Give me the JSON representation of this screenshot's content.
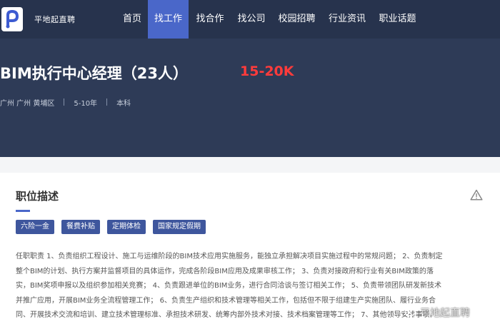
{
  "navbar": {
    "brand": "平地起直聘",
    "items": [
      {
        "label": "首页"
      },
      {
        "label": "找工作"
      },
      {
        "label": "找合作"
      },
      {
        "label": "找公司"
      },
      {
        "label": "校园招聘"
      },
      {
        "label": "行业资讯"
      },
      {
        "label": "职业话题"
      }
    ],
    "active_item": "找工作"
  },
  "job": {
    "title": "BIM执行中心经理（23人）",
    "salary": "15-20K",
    "location": "广州 广州 黄埔区",
    "experience": "5-10年",
    "education": "本科"
  },
  "description": {
    "section_title": "职位描述",
    "tags": [
      "六险一金",
      "餐费补贴",
      "定期体检",
      "国家规定假期"
    ],
    "text": "任职职责 1、负责组织工程设计、施工与运维阶段的BIM技术应用实施服务，能独立承担解决项目实施过程中的常规问题； 2、负责制定\n整个BIM的计划、执行方案并监督项目的具体运作，完成各阶段BIM应用及成果审核工作； 3、负责对接政府和行业有关BIM政策的落\n实，BIM奖项申报以及组织参加相关竞赛； 4、负责跟进单位的BIM业务，进行合同洽谈与签订相关工作； 5、负责带领团队研发新技术\n并推广应用，开展BIM业务全流程管理工作； 6、负责生产组织和技术管理等相关工作，包括但不限于组建生产实施团队、履行业务合\n同、开展技术交流和培训、建立技术管理标准、承担技术研发、统筹内部外技术对接、技术档案管理等工作； 7、其他领导安排事项。"
  },
  "watermark": "平地起直聘",
  "colors": {
    "nav_bg": "#27334d",
    "hero_bg": "#2e3b57",
    "active_nav": "#4a67c9",
    "salary": "#ff3b3b",
    "tag_bg": "#3e569d"
  },
  "icons": {
    "logo": "brand-logo-icon",
    "report": "warning-triangle-icon",
    "watermark": "weibo-icon"
  }
}
